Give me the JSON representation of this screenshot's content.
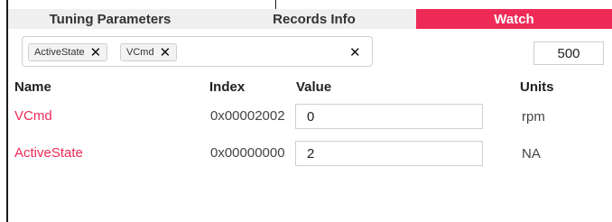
{
  "tabs": [
    {
      "label": "Tuning Parameters",
      "active": false
    },
    {
      "label": "Records Info",
      "active": false
    },
    {
      "label": "Watch",
      "active": true
    }
  ],
  "filter": {
    "chips": [
      {
        "label": "ActiveState"
      },
      {
        "label": "VCmd"
      }
    ],
    "chip_remove_glyph": "✕",
    "clear_glyph": "✕"
  },
  "count_value": "500",
  "table": {
    "headers": {
      "name": "Name",
      "index": "Index",
      "value": "Value",
      "units": "Units"
    },
    "rows": [
      {
        "name": "VCmd",
        "index": "0x00002002",
        "value": "0",
        "units": "rpm"
      },
      {
        "name": "ActiveState",
        "index": "0x00000000",
        "value": "2",
        "units": "NA"
      }
    ]
  },
  "colors": {
    "accent": "#ee2a56",
    "tab_background": "#efefef",
    "border": "#cfcfcf"
  },
  "icons": {
    "chip_remove": "close-icon",
    "clear_all": "close-icon"
  }
}
